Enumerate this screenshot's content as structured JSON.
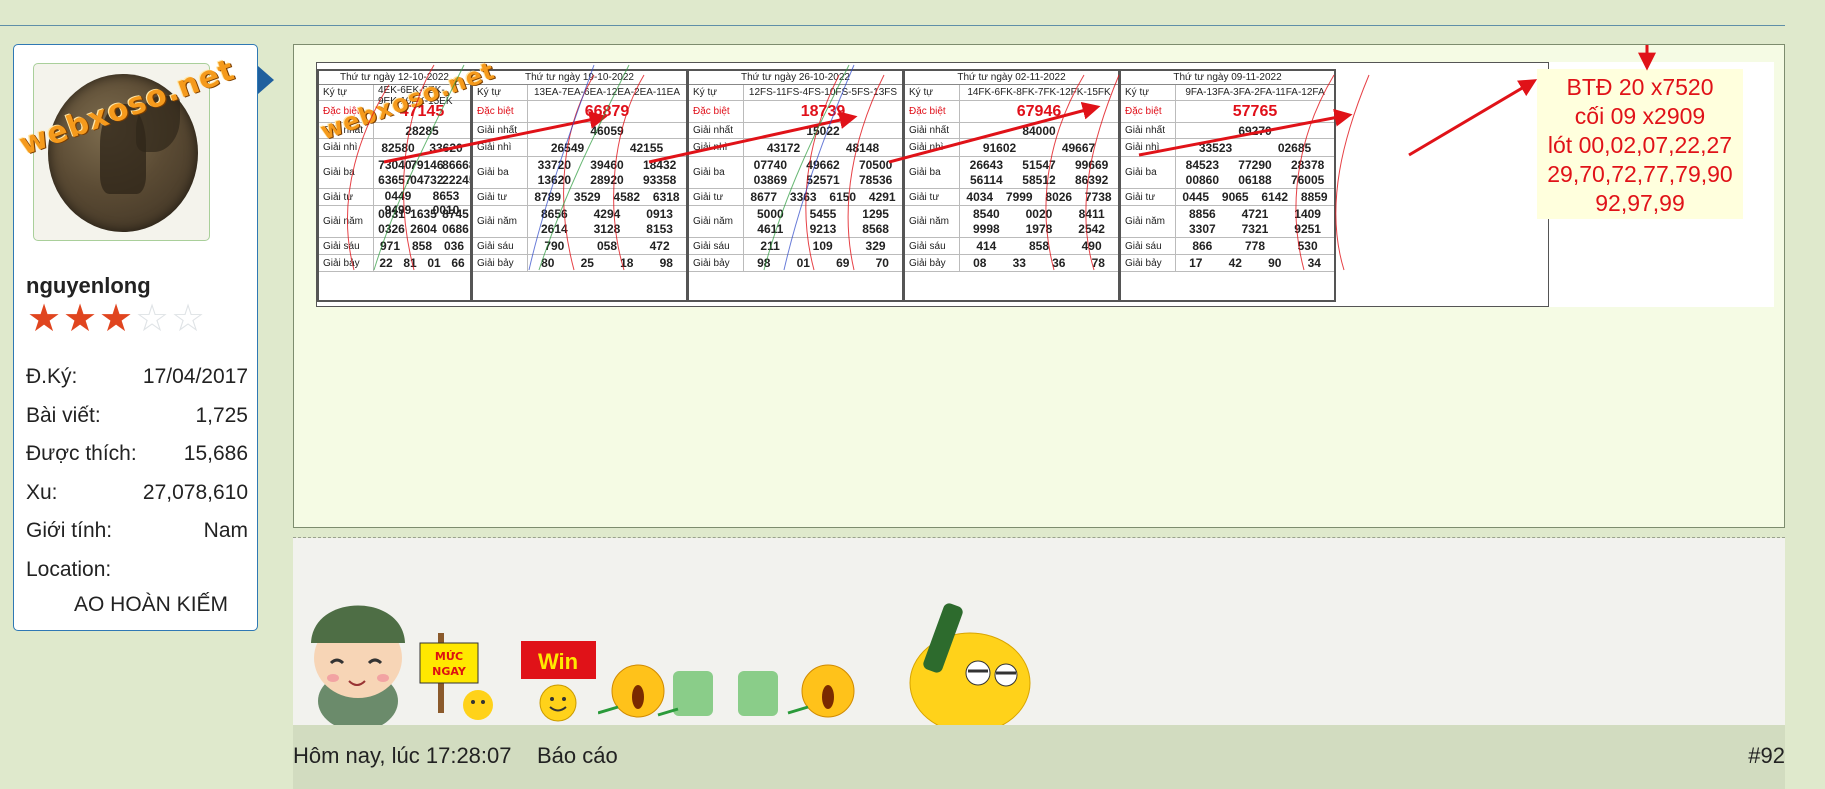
{
  "watermark": "webxoso.net",
  "user": {
    "name": "nguyenlong",
    "stars_filled": 3,
    "stars_total": 5,
    "stats": [
      {
        "label": "Đ.Ký:",
        "value": "17/04/2017"
      },
      {
        "label": "Bài viết:",
        "value": "1,725"
      },
      {
        "label": "Được thích:",
        "value": "15,686"
      },
      {
        "label": "Xu:",
        "value": "27,078,610"
      },
      {
        "label": "Giới tính:",
        "value": "Nam"
      },
      {
        "label": "Location:",
        "value": ""
      }
    ],
    "location": "AO HOÀN KIẾM"
  },
  "tickets": [
    {
      "date": "Thứ tư ngày 12-10-2022",
      "kytu": "4EK-6EK-8EK-9EK-10EK-15EK",
      "dacbiet": "47145",
      "nhat": "28285",
      "nhi": [
        "82580",
        "33620"
      ],
      "ba": [
        "73040",
        "79146",
        "86668",
        "63657",
        "04732",
        "22245"
      ],
      "tu": [
        "0449",
        "8653",
        "9499",
        "0010"
      ],
      "nam": [
        "0031",
        "1635",
        "8745",
        "0326",
        "2604",
        "0686"
      ],
      "sau": [
        "971",
        "858",
        "036"
      ],
      "bay": [
        "22",
        "81",
        "01",
        "66"
      ]
    },
    {
      "date": "Thứ tư ngày 19-10-2022",
      "kytu": "13EA-7EA-6EA-12EA-2EA-11EA",
      "dacbiet": "66879",
      "nhat": "46059",
      "nhi": [
        "26549",
        "42155"
      ],
      "ba": [
        "33720",
        "39460",
        "18432",
        "13620",
        "28920",
        "93358"
      ],
      "tu": [
        "8789",
        "3529",
        "4582",
        "6318"
      ],
      "nam": [
        "8656",
        "4294",
        "0913",
        "2614",
        "3128",
        "8153"
      ],
      "sau": [
        "790",
        "058",
        "472"
      ],
      "bay": [
        "80",
        "25",
        "18",
        "98"
      ]
    },
    {
      "date": "Thứ tư ngày 26-10-2022",
      "kytu": "12FS-11FS-4FS-10FS-5FS-13FS",
      "dacbiet": "18739",
      "nhat": "15022",
      "nhi": [
        "43172",
        "48148"
      ],
      "ba": [
        "07740",
        "49662",
        "70500",
        "03869",
        "52571",
        "78536"
      ],
      "tu": [
        "8677",
        "3363",
        "6150",
        "4291"
      ],
      "nam": [
        "5000",
        "5455",
        "1295",
        "4611",
        "9213",
        "8568"
      ],
      "sau": [
        "211",
        "109",
        "329"
      ],
      "bay": [
        "98",
        "01",
        "69",
        "70"
      ]
    },
    {
      "date": "Thứ tư ngày 02-11-2022",
      "kytu": "14FK-6FK-8FK-7FK-12FK-15FK",
      "dacbiet": "67946",
      "nhat": "84000",
      "nhi": [
        "91602",
        "49667"
      ],
      "ba": [
        "26643",
        "51547",
        "99669",
        "56114",
        "58512",
        "86392"
      ],
      "tu": [
        "4034",
        "7999",
        "8026",
        "7738"
      ],
      "nam": [
        "8540",
        "0020",
        "8411",
        "9998",
        "1978",
        "2542"
      ],
      "sau": [
        "414",
        "858",
        "490"
      ],
      "bay": [
        "08",
        "33",
        "36",
        "78"
      ]
    },
    {
      "date": "Thứ tư ngày 09-11-2022",
      "kytu": "9FA-13FA-3FA-2FA-11FA-12FA",
      "dacbiet": "57765",
      "nhat": "69270",
      "nhi": [
        "33523",
        "02685"
      ],
      "ba": [
        "84523",
        "77290",
        "28378",
        "00860",
        "06188",
        "76005"
      ],
      "tu": [
        "0445",
        "9065",
        "6142",
        "8859"
      ],
      "nam": [
        "8856",
        "4721",
        "1409",
        "3307",
        "7321",
        "9251"
      ],
      "sau": [
        "866",
        "778",
        "530"
      ],
      "bay": [
        "17",
        "42",
        "90",
        "34"
      ]
    }
  ],
  "row_labels": {
    "kytu": "Ký tự",
    "dacbiet": "Đặc biệt",
    "nhat": "Giải nhất",
    "nhi": "Giải nhì",
    "ba": "Giải ba",
    "tu": "Giải tư",
    "nam": "Giải năm",
    "sau": "Giải sáu",
    "bay": "Giải bảy"
  },
  "note_lines": [
    "BTĐ 20 x7520",
    "cối 09 x2909",
    "lót 00,02,07,22,27",
    "29,70,72,77,79,90",
    "92,97,99"
  ],
  "smileys": {
    "sign_text": "MỨC NGAY",
    "win_text": "Win"
  },
  "footer": {
    "time": "Hôm nay, lúc 17:28:07",
    "report": "Báo cáo",
    "post_number": "#92"
  },
  "colors": {
    "page_bg": "#dfe9cc",
    "accent_blue": "#2f78b4",
    "red": "#e01218",
    "star": "#e0451f"
  }
}
